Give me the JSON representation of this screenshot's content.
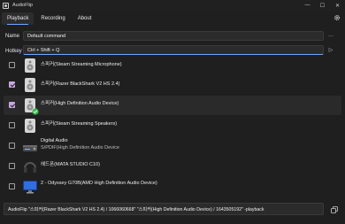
{
  "window": {
    "title": "AudioFlip",
    "minimize": "—",
    "maximize": "☐",
    "close": "✕"
  },
  "tabs": [
    {
      "label": "Playback",
      "active": true
    },
    {
      "label": "Recording",
      "active": false
    },
    {
      "label": "About",
      "active": false
    }
  ],
  "form": {
    "name_label": "Name",
    "name_value": "Default command",
    "name_more": "···",
    "hotkey_label": "Hotkey",
    "hotkey_value": "Ctrl + Shift + Q",
    "play_icon": "▷"
  },
  "devices": [
    {
      "name": "스피커(Steam Streaming Microphone)",
      "sub": "",
      "checked": false,
      "default": false,
      "icon": "speaker-icon"
    },
    {
      "name": "스피커(Razer BlackShark V2 HS 2.4)",
      "sub": "",
      "checked": true,
      "default": false,
      "icon": "speaker-icon"
    },
    {
      "name": "스피커(High Definition Audio Device)",
      "sub": "",
      "checked": true,
      "default": true,
      "icon": "speaker-icon"
    },
    {
      "name": "스피커(Steam Streaming Speakers)",
      "sub": "",
      "checked": false,
      "default": false,
      "icon": "speaker-icon"
    },
    {
      "name": "Digital Audio",
      "sub": "S/PDIF(High Definition Audio Device",
      "checked": false,
      "default": false,
      "icon": "receiver-icon"
    },
    {
      "name": "헤드폰(MATA STUDIO C10)",
      "sub": "",
      "checked": false,
      "default": false,
      "icon": "headphones-icon"
    },
    {
      "name": "2 - Odyssey G70B(AMD High Definition Audio Device)",
      "sub": "",
      "checked": false,
      "default": false,
      "icon": "monitor-icon"
    }
  ],
  "command_line": "AudioFlip \"스피커(Razer BlackShark V2 HS 2.4) / 1066060668\" \"스피커(High Definition Audio Device) / 1643505192\" -playback",
  "colors": {
    "accent": "#6ea8ff",
    "checkbox": "#c9a6e4",
    "default_badge": "#3fb950"
  }
}
